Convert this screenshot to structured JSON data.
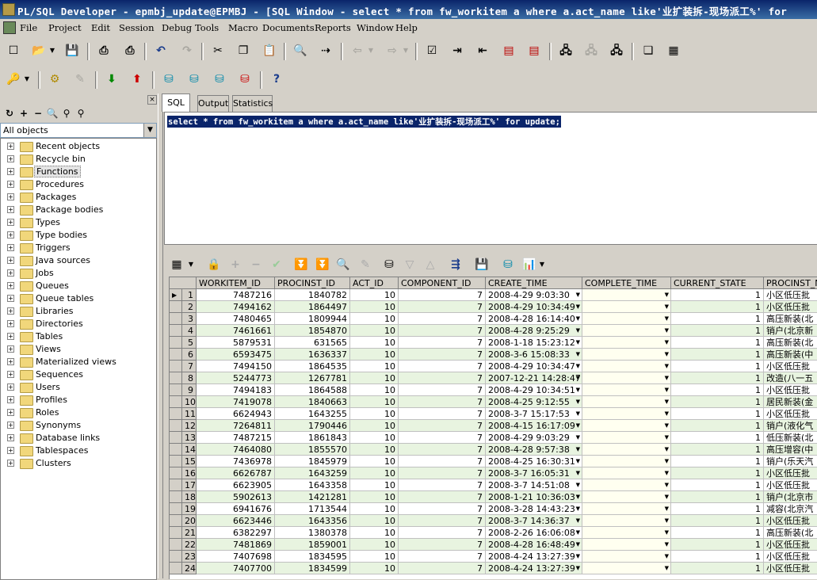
{
  "window": {
    "title": "PL/SQL Developer - epmbj_update@EPMBJ - [SQL Window - select * from fw_workitem a where a.act_name like'业扩装拆-现场派工%' for"
  },
  "menu": [
    "File",
    "Project",
    "Edit",
    "Session",
    "Debug",
    "Tools",
    "Macro",
    "Documents",
    "Reports",
    "Window",
    "Help"
  ],
  "object_browser": {
    "filter": "All objects",
    "items": [
      "Recent objects",
      "Recycle bin",
      "Functions",
      "Procedures",
      "Packages",
      "Package bodies",
      "Types",
      "Type bodies",
      "Triggers",
      "Java sources",
      "Jobs",
      "Queues",
      "Queue tables",
      "Libraries",
      "Directories",
      "Tables",
      "Views",
      "Materialized views",
      "Sequences",
      "Users",
      "Profiles",
      "Roles",
      "Synonyms",
      "Database links",
      "Tablespaces",
      "Clusters"
    ],
    "selected": "Functions"
  },
  "tabs": [
    "SQL",
    "Output",
    "Statistics"
  ],
  "editor": {
    "sql": "select * from fw_workitem a where a.act_name like'业扩装拆-现场派工%' for update;"
  },
  "grid": {
    "columns": [
      "WORKITEM_ID",
      "PROCINST_ID",
      "ACT_ID",
      "COMPONENT_ID",
      "CREATE_TIME",
      "COMPLETE_TIME",
      "CURRENT_STATE",
      "PROCINST_N"
    ],
    "rows": [
      [
        "1",
        "7487216",
        "1840782",
        "10",
        "7",
        "2008-4-29 9:03:30",
        "",
        "1",
        "小区低压批"
      ],
      [
        "2",
        "7494162",
        "1864497",
        "10",
        "7",
        "2008-4-29 10:34:49",
        "",
        "1",
        "小区低压批"
      ],
      [
        "3",
        "7480465",
        "1809944",
        "10",
        "7",
        "2008-4-28 16:14:40",
        "",
        "1",
        "高压新装(北"
      ],
      [
        "4",
        "7461661",
        "1854870",
        "10",
        "7",
        "2008-4-28 9:25:29",
        "",
        "1",
        "销户(北京新"
      ],
      [
        "5",
        "5879531",
        "631565",
        "10",
        "7",
        "2008-1-18 15:23:12",
        "",
        "1",
        "高压新装(北"
      ],
      [
        "6",
        "6593475",
        "1636337",
        "10",
        "7",
        "2008-3-6 15:08:33",
        "",
        "1",
        "高压新装(中"
      ],
      [
        "7",
        "7494150",
        "1864535",
        "10",
        "7",
        "2008-4-29 10:34:47",
        "",
        "1",
        "小区低压批"
      ],
      [
        "8",
        "5244773",
        "1267781",
        "10",
        "7",
        "2007-12-21 14:28:47",
        "",
        "1",
        "改造(八一五"
      ],
      [
        "9",
        "7494183",
        "1864588",
        "10",
        "7",
        "2008-4-29 10:34:51",
        "",
        "1",
        "小区低压批"
      ],
      [
        "10",
        "7419078",
        "1840663",
        "10",
        "7",
        "2008-4-25 9:12:55",
        "",
        "1",
        "居民新装(金"
      ],
      [
        "11",
        "6624943",
        "1643255",
        "10",
        "7",
        "2008-3-7 15:17:53",
        "",
        "1",
        "小区低压批"
      ],
      [
        "12",
        "7264811",
        "1790446",
        "10",
        "7",
        "2008-4-15 16:17:09",
        "",
        "1",
        "销户(液化气"
      ],
      [
        "13",
        "7487215",
        "1861843",
        "10",
        "7",
        "2008-4-29 9:03:29",
        "",
        "1",
        "低压新装(北"
      ],
      [
        "14",
        "7464080",
        "1855570",
        "10",
        "7",
        "2008-4-28 9:57:38",
        "",
        "1",
        "高压增容(中"
      ],
      [
        "15",
        "7436978",
        "1845979",
        "10",
        "7",
        "2008-4-25 16:30:31",
        "",
        "1",
        "销户(乐天汽"
      ],
      [
        "16",
        "6626787",
        "1643259",
        "10",
        "7",
        "2008-3-7 16:05:31",
        "",
        "1",
        "小区低压批"
      ],
      [
        "17",
        "6623905",
        "1643358",
        "10",
        "7",
        "2008-3-7 14:51:08",
        "",
        "1",
        "小区低压批"
      ],
      [
        "18",
        "5902613",
        "1421281",
        "10",
        "7",
        "2008-1-21 10:36:03",
        "",
        "1",
        "销户(北京市"
      ],
      [
        "19",
        "6941676",
        "1713544",
        "10",
        "7",
        "2008-3-28 14:43:23",
        "",
        "1",
        "减容(北京汽"
      ],
      [
        "20",
        "6623446",
        "1643356",
        "10",
        "7",
        "2008-3-7 14:36:37",
        "",
        "1",
        "小区低压批"
      ],
      [
        "21",
        "6382297",
        "1380378",
        "10",
        "7",
        "2008-2-26 16:06:08",
        "",
        "1",
        "高压新装(北"
      ],
      [
        "22",
        "7481869",
        "1859001",
        "10",
        "7",
        "2008-4-28 16:48:49",
        "",
        "1",
        "小区低压批"
      ],
      [
        "23",
        "7407698",
        "1834595",
        "10",
        "7",
        "2008-4-24 13:27:39",
        "",
        "1",
        "小区低压批"
      ],
      [
        "24",
        "7407700",
        "1834599",
        "10",
        "7",
        "2008-4-24 13:27:39",
        "",
        "1",
        "小区低压批"
      ]
    ]
  }
}
